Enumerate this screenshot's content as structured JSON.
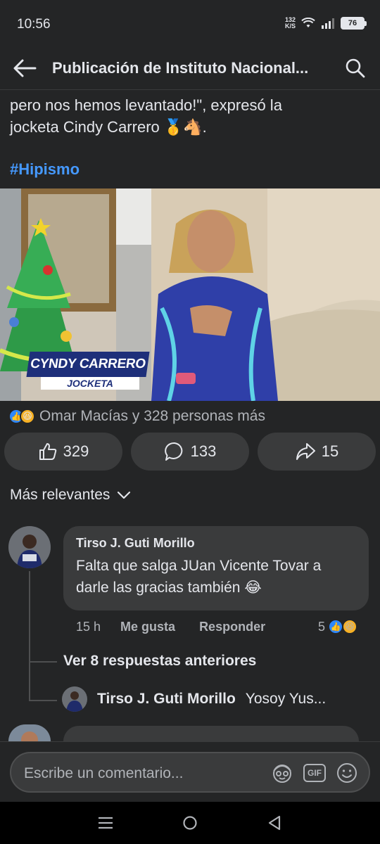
{
  "status_bar": {
    "time": "10:56",
    "net_speed_value": "132",
    "net_speed_unit": "K/S",
    "battery": "76"
  },
  "header": {
    "title": "Publicación de Instituto Nacional..."
  },
  "post": {
    "text_line1": "pero nos hemos levantado!\", expresó la",
    "text_line2": "jocketa Cindy Carrero 🥇🐴.",
    "hashtag": "#Hipismo"
  },
  "video": {
    "lower_third_name": "CYNDY CARRERO",
    "lower_third_role": "JOCKETA"
  },
  "reactions": {
    "summary": "Omar Macías y 328 personas más"
  },
  "actions": {
    "like_count": "329",
    "comment_count": "133",
    "share_count": "15"
  },
  "comments_sort": {
    "label": "Más relevantes"
  },
  "comment": {
    "author": "Tirso J. Guti Morillo",
    "text": "Falta que salga JUan Vicente Tovar a darle las gracias también 😂",
    "time": "15 h",
    "like_label": "Me gusta",
    "reply_label": "Responder",
    "reaction_count": "5",
    "view_replies": "Ver 8 respuestas anteriores",
    "reply_author": "Tirso J. Guti Morillo",
    "reply_preview": "Yosoy Yus..."
  },
  "composer": {
    "placeholder": "Escribe un comentario..."
  },
  "colors": {
    "background": "#242526",
    "surface": "#3a3b3c",
    "link": "#4599ff",
    "like_blue": "#2d88ff"
  }
}
